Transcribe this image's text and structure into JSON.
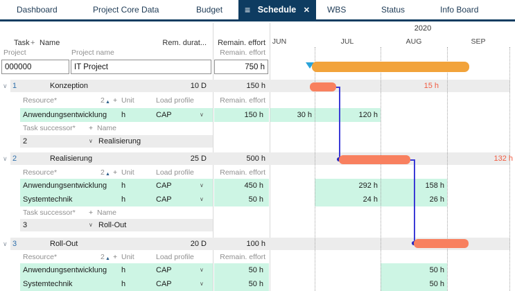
{
  "tabs": [
    {
      "label": "Dashboard"
    },
    {
      "label": "Project Core Data"
    },
    {
      "label": "Budget"
    },
    {
      "label": "Schedule"
    },
    {
      "label": "WBS"
    },
    {
      "label": "Status"
    },
    {
      "label": "Info Board"
    }
  ],
  "active_tab": "Schedule",
  "icons": {
    "menu": "≡",
    "close": "✕",
    "expand": "∨",
    "dropdown": "∨",
    "add": "+",
    "sort_asc": "▲"
  },
  "columns": {
    "task": "Task",
    "name": "Name",
    "rem_duration": "Rem. durat...",
    "remain_effort": "Remain. effort"
  },
  "project_row": {
    "id_label": "Project",
    "name_label": "Project name",
    "effort_label": "Remain. effort",
    "id": "000000",
    "name": "IT Project",
    "effort": "750 h"
  },
  "section_headers": {
    "resource": {
      "label": "Resource*",
      "count": "2",
      "unit": "Unit",
      "load_profile": "Load profile",
      "effort": "Remain. effort"
    },
    "successor": {
      "label": "Task successor*",
      "name": "Name"
    }
  },
  "tasks": [
    {
      "id": "1",
      "name": "Konzeption",
      "duration": "10 D",
      "effort": "150 h",
      "overload": "15 h",
      "resources": [
        {
          "name": "Anwendungsentwicklung",
          "unit": "h",
          "load_profile": "CAP",
          "effort": "150 h",
          "monthly": [
            {
              "month": "JUN",
              "value": "30 h"
            },
            {
              "month": "JUL",
              "value": "120 h"
            }
          ]
        }
      ],
      "successors": [
        {
          "id": "2",
          "name": "Realisierung"
        }
      ]
    },
    {
      "id": "2",
      "name": "Realisierung",
      "duration": "25 D",
      "effort": "500 h",
      "overload": "132 h",
      "resources": [
        {
          "name": "Anwendungsentwicklung",
          "unit": "h",
          "load_profile": "CAP",
          "effort": "450 h",
          "monthly": [
            {
              "month": "JUL",
              "value": "292 h"
            },
            {
              "month": "AUG",
              "value": "158 h"
            }
          ]
        },
        {
          "name": "Systemtechnik",
          "unit": "h",
          "load_profile": "CAP",
          "effort": "50 h",
          "monthly": [
            {
              "month": "JUL",
              "value": "24 h"
            },
            {
              "month": "AUG",
              "value": "26 h"
            }
          ]
        }
      ],
      "successors": [
        {
          "id": "3",
          "name": "Roll-Out"
        }
      ]
    },
    {
      "id": "3",
      "name": "Roll-Out",
      "duration": "20 D",
      "effort": "100 h",
      "overload": "",
      "resources": [
        {
          "name": "Anwendungsentwicklung",
          "unit": "h",
          "load_profile": "CAP",
          "effort": "50 h",
          "monthly": [
            {
              "month": "AUG",
              "value": "50 h"
            }
          ]
        },
        {
          "name": "Systemtechnik",
          "unit": "h",
          "load_profile": "CAP",
          "effort": "50 h",
          "monthly": [
            {
              "month": "AUG",
              "value": "50 h"
            }
          ]
        }
      ],
      "successors": []
    }
  ],
  "gantt": {
    "year": "2020",
    "months": [
      "JUN",
      "JUL",
      "AUG",
      "SEP"
    ]
  },
  "colors": {
    "navy": "#0e3c61",
    "summary_bar": "#f2a33b",
    "task_bar": "#f8805f",
    "resource_cell": "#cdf5e4",
    "row_band": "#ececec",
    "overload_text": "#f15b41",
    "link_line": "#3a3ad6",
    "milestone_marker": "#2aa3d9",
    "task_id": "#2e6fab"
  }
}
